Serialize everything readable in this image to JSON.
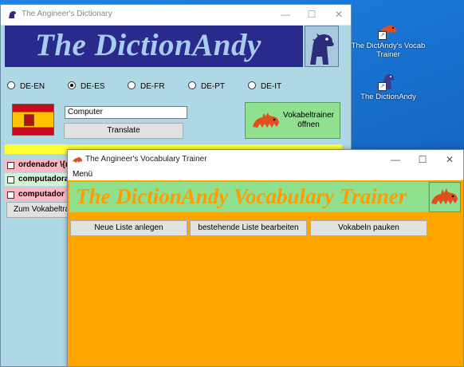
{
  "desktop": {
    "icons": [
      {
        "label": "The DictAndy's Vocab Trainer",
        "icon": "dino-shortcut-icon"
      },
      {
        "label": "The DictionAndy",
        "icon": "dino-shortcut-icon"
      }
    ]
  },
  "dictionary_window": {
    "title": "The Angineer's Dictionary",
    "banner_title": "The DictionAndy",
    "language_options": [
      "DE-EN",
      "DE-ES",
      "DE-FR",
      "DE-PT",
      "DE-IT"
    ],
    "selected_language": "DE-ES",
    "search_value": "Computer",
    "translate_label": "Translate",
    "trainer_button_label": "Vokabeltrainer öffnen",
    "results": [
      "ordenador \\{m\\",
      "computadora \\",
      "computador \\{n"
    ],
    "zum_button_label": "Zum Vokabeltrain"
  },
  "trainer_window": {
    "title": "The Angineer's Vocabulary Trainer",
    "menu_label": "Menü",
    "banner_title": "The DictionAndy Vocabulary Trainer",
    "buttons": [
      "Neue Liste anlegen",
      "bestehende Liste bearbeiten",
      "Vokabeln pauken"
    ]
  },
  "colors": {
    "dict_bg": "#aed8e6",
    "banner_navy": "#2a2a8c",
    "trainer_bg": "#ffa500",
    "trainer_banner": "#8fe08f",
    "flag_red": "#c60b1e",
    "flag_yellow": "#ffc400"
  }
}
